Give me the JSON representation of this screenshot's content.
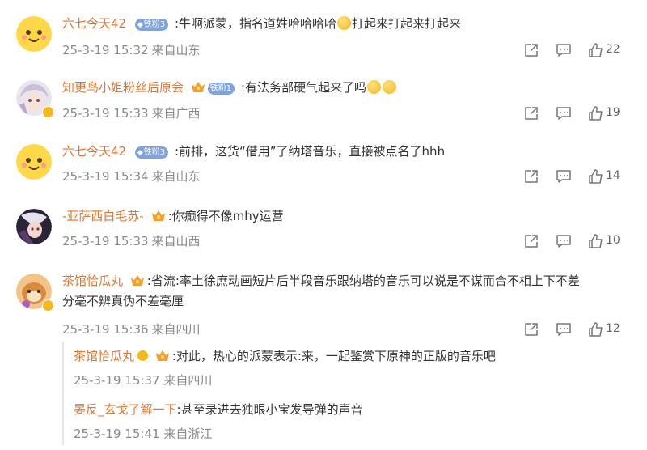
{
  "comments": [
    {
      "username": "六七今天42",
      "badge": "铁粉3",
      "text": ":牛啊派蒙，指名道姓哈哈哈哈",
      "text_after_emoji": "打起来打起来打起来",
      "date": "25-3-19 15:32",
      "location": "来自山东",
      "likes": "22"
    },
    {
      "username": "知更鸟小姐粉丝后原会",
      "badge": "铁粉1",
      "text": ":有法务部硬气起来了吗",
      "date": "25-3-19 15:33",
      "location": "来自广西",
      "likes": "19"
    },
    {
      "username": "六七今天42",
      "badge": "铁粉3",
      "text": ":前排，这货“借用”了纳塔音乐，直接被点名了hhh",
      "date": "25-3-19 15:34",
      "location": "来自山东",
      "likes": "14"
    },
    {
      "username": "-亚萨西白毛苏-",
      "text": ":你癫得不像mhy运营",
      "date": "25-3-19 15:33",
      "location": "来自山西",
      "likes": "10"
    },
    {
      "username": "茶馆恰瓜丸",
      "text": ":省流:率土徐庶动画短片后半段音乐跟纳塔的音乐可以说是不谋而合不相上下不差",
      "text_line2": "分毫不辨真伪不差毫厘",
      "date": "25-3-19 15:36",
      "location": "来自四川",
      "likes": "12"
    }
  ],
  "replies": [
    {
      "username": "茶馆恰瓜丸",
      "text": ":对此，热心的派蒙表示:来，一起鉴赏下原神的正版的音乐吧",
      "date": "25-3-19 15:37",
      "location": "来自四川"
    },
    {
      "username": "晏反_玄戈了解一下",
      "text": ":甚至录进去独眼小宝发导弹的声音",
      "date": "25-3-19 15:41",
      "location": "来自浙江"
    }
  ],
  "colors": {
    "username": "#e1772f",
    "text": "#333333",
    "meta": "#8a8a8a",
    "fan_badge": "#7ea3e2",
    "verified": "#f6b917"
  },
  "icons": {
    "share": "share-icon",
    "comment": "comment-icon",
    "like": "like-icon"
  }
}
